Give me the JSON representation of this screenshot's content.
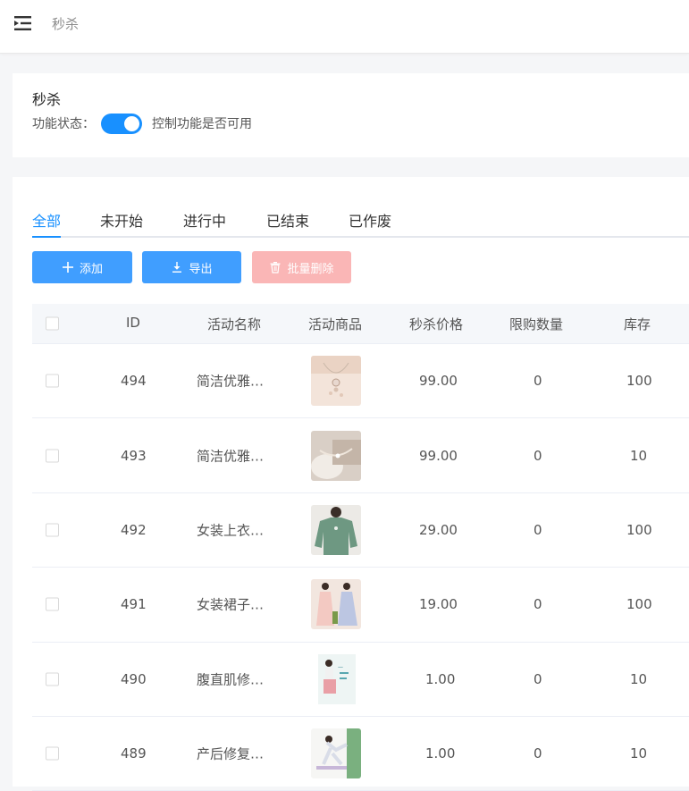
{
  "topbar": {
    "title": "秒杀"
  },
  "feature": {
    "title": "秒杀",
    "status_label": "功能状态：",
    "status_desc": "控制功能是否可用",
    "enabled": true
  },
  "tabs": [
    {
      "label": "全部",
      "active": true
    },
    {
      "label": "未开始",
      "active": false
    },
    {
      "label": "进行中",
      "active": false
    },
    {
      "label": "已结束",
      "active": false
    },
    {
      "label": "已作废",
      "active": false
    }
  ],
  "toolbar": {
    "add_label": "添加",
    "export_label": "导出",
    "batch_delete_label": "批量删除"
  },
  "table": {
    "headers": {
      "id": "ID",
      "name": "活动名称",
      "product": "活动商品",
      "price": "秒杀价格",
      "limit": "限购数量",
      "stock": "库存"
    },
    "rows": [
      {
        "id": "494",
        "name": "简洁优雅…",
        "price": "99.00",
        "limit": "0",
        "stock": "100",
        "product_icon": "necklace-image"
      },
      {
        "id": "493",
        "name": "简洁优雅…",
        "price": "99.00",
        "limit": "0",
        "stock": "10",
        "product_icon": "bracelet-image"
      },
      {
        "id": "492",
        "name": "女装上衣…",
        "price": "29.00",
        "limit": "0",
        "stock": "100",
        "product_icon": "sweater-image"
      },
      {
        "id": "491",
        "name": "女装裙子…",
        "price": "19.00",
        "limit": "0",
        "stock": "100",
        "product_icon": "dress-image"
      },
      {
        "id": "490",
        "name": "腹直肌修…",
        "price": "1.00",
        "limit": "0",
        "stock": "10",
        "product_icon": "fitness-image"
      },
      {
        "id": "489",
        "name": "产后修复…",
        "price": "1.00",
        "limit": "0",
        "stock": "10",
        "product_icon": "yoga-image"
      }
    ]
  },
  "colors": {
    "accent": "#1890ff",
    "button": "#409eff",
    "danger_disabled": "#fab6b6"
  }
}
